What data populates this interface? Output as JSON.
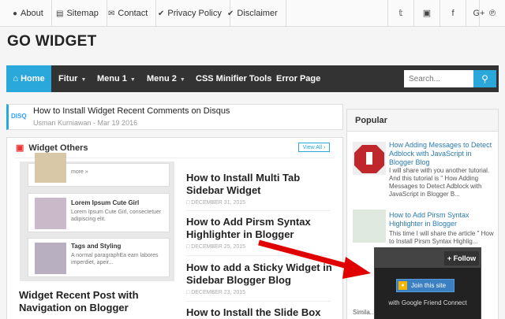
{
  "topnav": {
    "links": [
      "About",
      "Sitemap",
      "Contact",
      "Privacy Policy",
      "Disclaimer"
    ],
    "icons": [
      "user-icon",
      "sitemap-icon",
      "envelope-icon",
      "check-circle-icon",
      "check-circle-icon"
    ],
    "social": [
      "twitter-icon",
      "instagram-icon",
      "facebook-icon",
      "google-plus-icon",
      "pinterest-icon"
    ]
  },
  "site": {
    "title": "GO WIDGET"
  },
  "nav": {
    "home": "Home",
    "items": [
      "Fitur",
      "Menu 1",
      "Menu 2",
      "CSS Minifier Tools",
      "Error Page"
    ],
    "search_placeholder": "Search..."
  },
  "ticker": {
    "logo": "DISQ",
    "title": "How to Install Widget Recent Comments on Disqus",
    "author": "Usman Kurniawan",
    "date": "Mar 19 2016"
  },
  "widget_others": {
    "heading": "Widget Others",
    "view_all": "View All",
    "thumb_items": [
      {
        "more": "more »"
      },
      {
        "title": "Lorem Ipsum Cute Girl",
        "text": "Lorem Ipsum Cute Girl, consectetuer adipiscing elit."
      },
      {
        "title": "Tags and Styling",
        "text": "A normal paragraphEa eam labores imperdiet, apeir..."
      }
    ],
    "featured_title": "Widget Recent Post with Navigation on Blogger",
    "posts": [
      {
        "title": "How to Install Multi Tab Sidebar Widget",
        "date": "DECEMBER 31, 2015"
      },
      {
        "title": "How to Add Pirsm Syntax Highlighter in Blogger",
        "date": "DECEMBER 25, 2015"
      },
      {
        "title": "How to add a Sticky Widget in Sidebar Blogger Blog",
        "date": "DECEMBER 23, 2015"
      },
      {
        "title": "How to Install the Slide Box",
        "date": ""
      }
    ]
  },
  "popular": {
    "heading": "Popular",
    "items": [
      {
        "title": "How Adding Messages to Detect Adblock with JavaScript in Blogger Blog",
        "snippet": "I will share with you another tutorial. And this tutorial is \" How Adding Messages to Detect Adblock with JavaScript in Blogger B..."
      },
      {
        "title": "How to Add Pirsm Syntax Highlighter in Blogger",
        "snippet": "This time I will share the article \" How to Install Pirsm Syntax Highlig... comme..."
      },
      {
        "title": "",
        "snippet": "Simila..."
      }
    ]
  },
  "follow": {
    "button": "+ Follow",
    "join": "Join this site",
    "provider": "with Google Friend Connect"
  },
  "colors": {
    "accent": "#2aa7db",
    "nav_bg": "#333333",
    "arrow": "#e00000"
  }
}
